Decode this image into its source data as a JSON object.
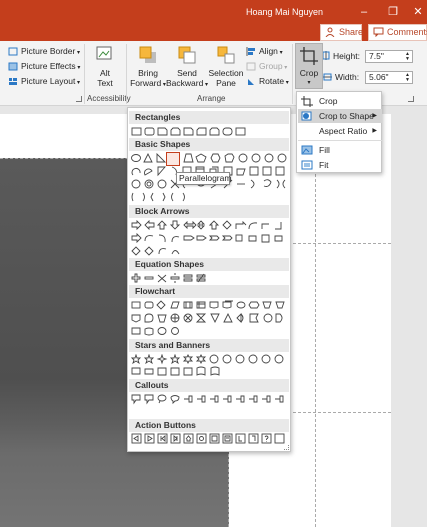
{
  "window": {
    "user_name": "Hoang Mai Nguyen",
    "controls": [
      "–",
      "❐",
      "✕"
    ]
  },
  "tab_buttons": {
    "share": "Share",
    "comments": "Comments"
  },
  "ribbon": {
    "picture_border": "Picture Border",
    "picture_effects": "Picture Effects",
    "picture_layout": "Picture Layout",
    "alt_text_line1": "Alt",
    "alt_text_line2": "Text",
    "bring_forward_line1": "Bring",
    "bring_forward_line2": "Forward",
    "send_backward_line1": "Send",
    "send_backward_line2": "Backward",
    "selection_pane_line1": "Selection",
    "selection_pane_line2": "Pane",
    "align": "Align",
    "group": "Group",
    "rotate": "Rotate",
    "crop": "Crop",
    "height_label": "Height:",
    "height_value": "7.5\"",
    "width_label": "Width:",
    "width_value": "5.06\"",
    "group_accessibility": "Accessibility",
    "group_arrange": "Arrange"
  },
  "crop_menu": {
    "items": [
      {
        "label": "Crop",
        "icon": "crop-icon"
      },
      {
        "label": "Crop to Shape",
        "icon": "crop-shape-icon"
      },
      {
        "label": "Aspect Ratio",
        "icon": ""
      },
      {
        "label": "Fill",
        "icon": "fill-icon"
      },
      {
        "label": "Fit",
        "icon": "fit-icon"
      }
    ],
    "highlighted": "Crop to Shape"
  },
  "gallery": {
    "categories": [
      "Rectangles",
      "Basic Shapes",
      "Block Arrows",
      "Equation Shapes",
      "Flowchart",
      "Stars and Banners",
      "Callouts",
      "Action Buttons"
    ],
    "tooltip": "Parallelogram"
  },
  "colors": {
    "accent": "#c43e1c",
    "ribbon": "#f3f3f3",
    "menu_highlight": "#d4d4d4"
  }
}
